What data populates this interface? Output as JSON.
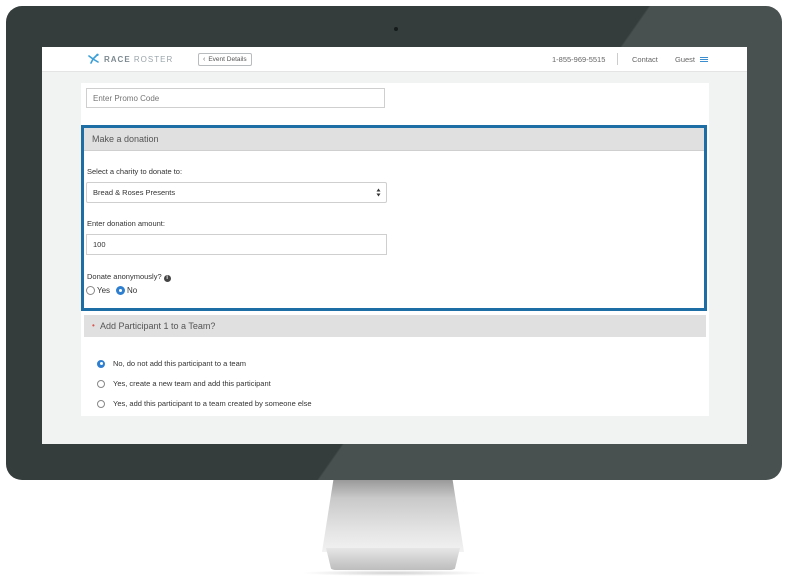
{
  "header": {
    "logo_text_bold": "RACE",
    "logo_text_light": "ROSTER",
    "event_details_label": "Event Details",
    "phone": "1-855-969-5515",
    "contact_label": "Contact",
    "guest_label": "Guest"
  },
  "promo": {
    "placeholder": "Enter Promo Code"
  },
  "donation": {
    "title": "Make a donation",
    "charity_label": "Select a charity to donate to:",
    "charity_selected": "Bread & Roses Presents",
    "amount_label": "Enter donation amount:",
    "amount_value": "100",
    "anonymous_label": "Donate anonymously?",
    "options": [
      {
        "label": "Yes",
        "checked": false
      },
      {
        "label": "No",
        "checked": true
      }
    ]
  },
  "team": {
    "title": "Add Participant 1 to a Team?",
    "options": [
      {
        "label": "No, do not add this participant to a team",
        "checked": true
      },
      {
        "label": "Yes, create a new team and add this participant",
        "checked": false
      },
      {
        "label": "Yes, add this participant to a team created by someone else",
        "checked": false
      }
    ]
  },
  "colors": {
    "accent": "#1c6ea4",
    "radio_checked": "#2f7fd0",
    "bezel": "#343c3c"
  }
}
